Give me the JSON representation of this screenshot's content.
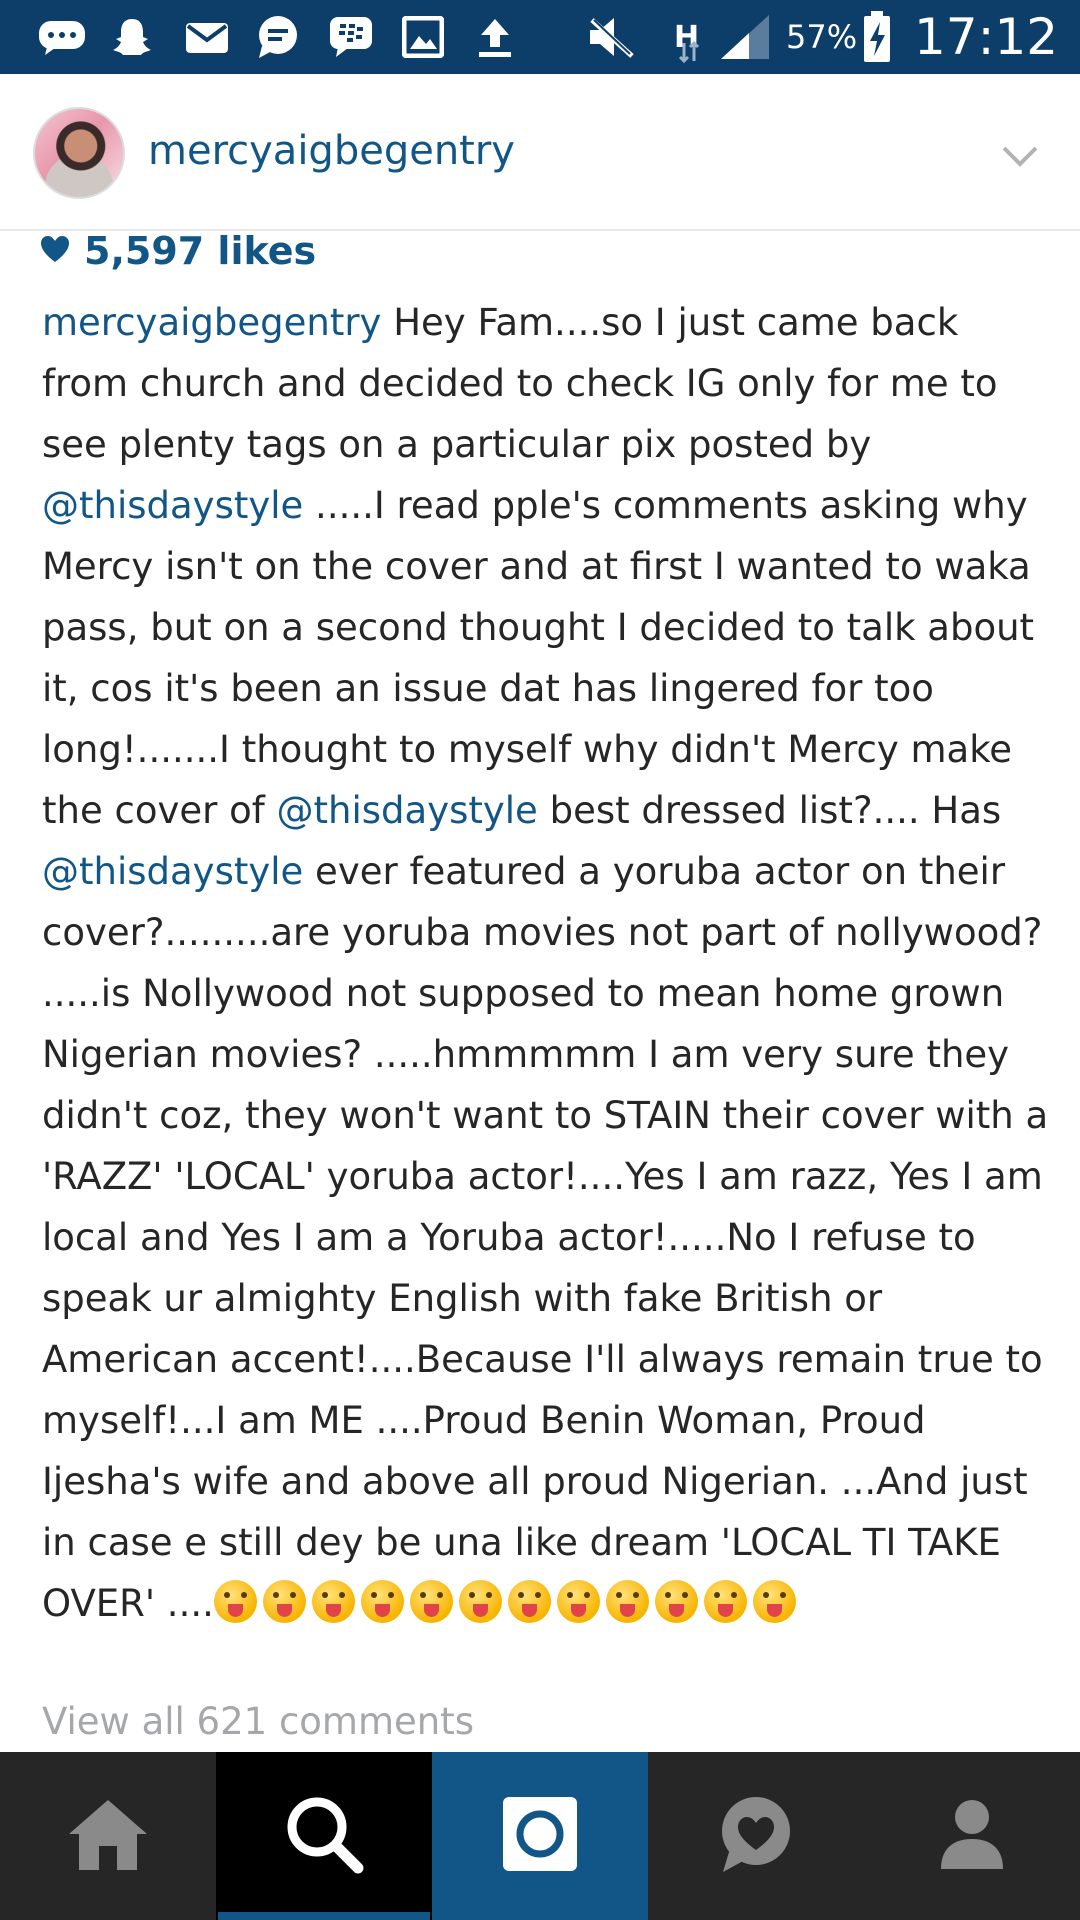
{
  "status_bar": {
    "battery": "57%",
    "time": "17:12",
    "network": "H",
    "icons": [
      "chat-bubble-icon",
      "snapchat-icon",
      "mail-icon",
      "message-icon",
      "bbm-icon",
      "gallery-icon",
      "upload-icon",
      "mute-icon",
      "network-h-icon",
      "signal-icon",
      "battery-charging-icon"
    ]
  },
  "post": {
    "username": "mercyaigbegentry",
    "likes": "5,597 likes",
    "caption_author": "mercyaigbegentry",
    "caption_parts": {
      "p1": " Hey Fam....so I just came back from church and decided to check IG only for me to see plenty tags on a particular pix posted by ",
      "m1": "@thisdaystyle",
      "p2": " .....I read pple's  comments asking why Mercy isn't on the cover  and at first I  wanted to waka pass, but on  a second thought I decided to talk about it, cos it's been an issue dat has lingered for too long!.......I thought to myself why didn't Mercy make the cover of ",
      "m2": "@thisdaystyle",
      "p3": "  best dressed list?.... Has ",
      "m3": "@thisdaystyle",
      "p4": " ever featured a yoruba actor on their cover?.........are yoruba movies not part of nollywood? .....is Nollywood not supposed to mean home grown Nigerian movies? .....hmmmmm I am very sure they didn't coz, they won't want to STAIN their cover with a 'RAZZ' 'LOCAL' yoruba actor!....Yes I am razz, Yes I am local and Yes I am a Yoruba actor!.....No I refuse to speak ur almighty English with fake British or American accent!....Because I'll always remain  true to myself!...I am ME ....Proud Benin Woman, Proud Ijesha's wife and above all proud Nigerian. ...And just in case e still dey be una like dream 'LOCAL TI TAKE OVER' ...."
    },
    "emoji_count": 12,
    "emoji_icon": "tongue-out-emoji-icon",
    "view_comments": "View all 621 comments"
  },
  "nav": {
    "items": [
      "home-icon",
      "search-icon",
      "camera-icon",
      "activity-heart-icon",
      "profile-icon"
    ],
    "active": "search"
  },
  "colors": {
    "status_bar": "#0d3e69",
    "link_blue": "#125688",
    "nav_bg": "#262626",
    "nav_active": "#000000",
    "camera_bg": "#125688",
    "muted_text": "#a5a7aa"
  }
}
